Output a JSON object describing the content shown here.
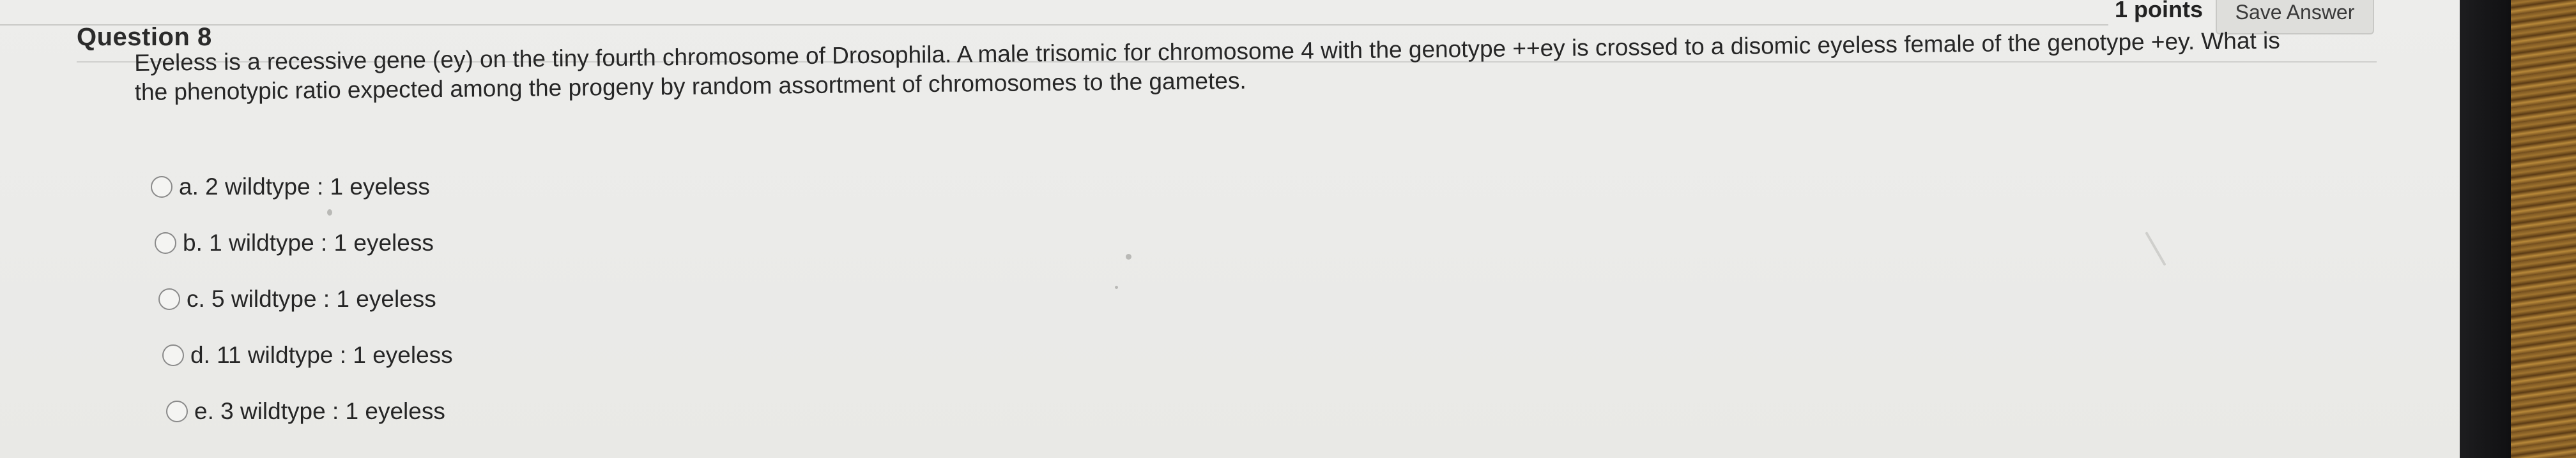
{
  "question": {
    "title": "Question 8",
    "points": "1 points",
    "save_label": "Save Answer",
    "text": "Eyeless is a recessive gene (ey) on the tiny fourth chromosome of Drosophila. A male trisomic for chromosome 4 with the genotype ++ey is crossed to a disomic eyeless female of the genotype +ey. What is the phenotypic ratio expected among the progeny by random assortment of chromosomes to the gametes."
  },
  "options": [
    {
      "label": "a. 2 wildtype : 1 eyeless"
    },
    {
      "label": "b. 1 wildtype : 1 eyeless"
    },
    {
      "label": "c. 5 wildtype : 1 eyeless"
    },
    {
      "label": "d. 11 wildtype : 1 eyeless"
    },
    {
      "label": "e. 3 wildtype : 1 eyeless"
    }
  ]
}
